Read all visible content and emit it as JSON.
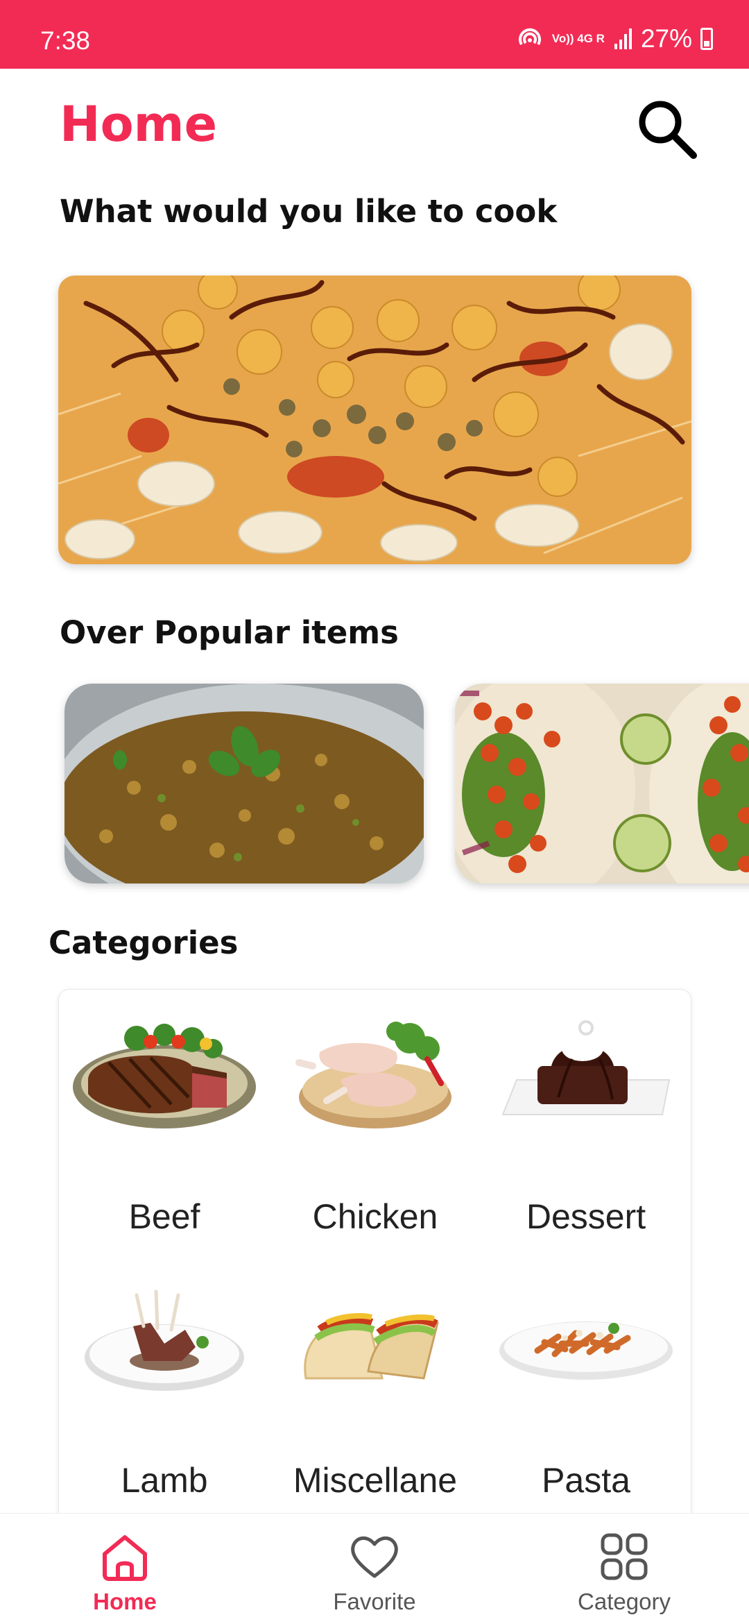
{
  "status_bar": {
    "time": "7:38",
    "network": "Vo)) 4G R",
    "battery": "27%"
  },
  "header": {
    "title": "Home"
  },
  "sections": {
    "cook_heading": "What would you like to cook",
    "popular_heading": "Over Popular items",
    "categories_heading": "Categories"
  },
  "categories": [
    {
      "label": "Beef"
    },
    {
      "label": "Chicken"
    },
    {
      "label": "Dessert"
    },
    {
      "label": "Lamb"
    },
    {
      "label": "Miscellane"
    },
    {
      "label": "Pasta"
    }
  ],
  "bottom_nav": {
    "items": [
      {
        "label": "Home",
        "active": true
      },
      {
        "label": "Favorite",
        "active": false
      },
      {
        "label": "Category",
        "active": false
      }
    ]
  },
  "colors": {
    "accent": "#f22b55",
    "text": "#111111",
    "inactive": "#555555"
  }
}
